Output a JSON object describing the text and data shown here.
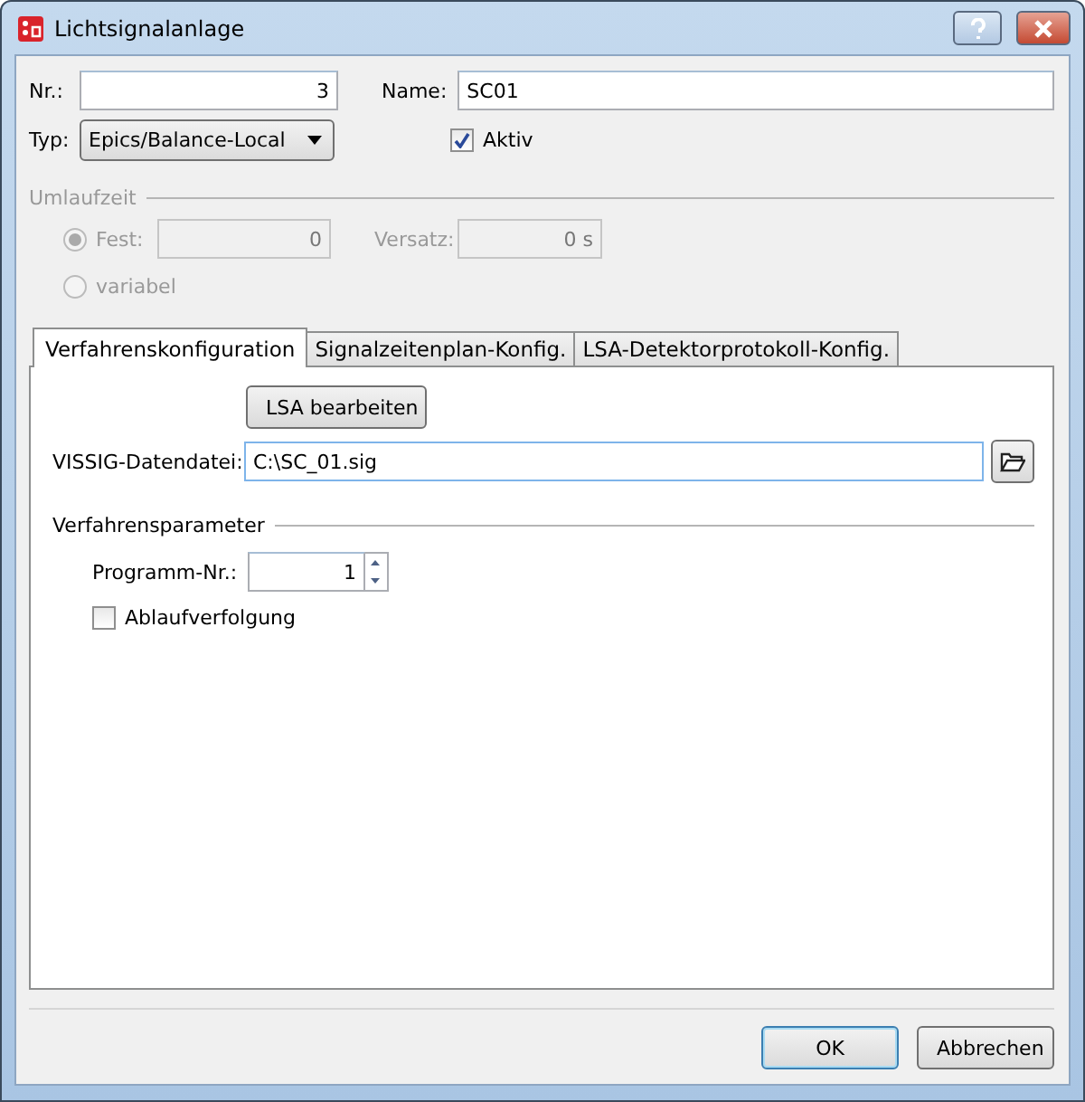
{
  "window": {
    "title": "Lichtsignalanlage"
  },
  "nr": {
    "label": "Nr.:",
    "value": "3"
  },
  "name": {
    "label": "Name:",
    "value": "SC01"
  },
  "typ": {
    "label": "Typ:",
    "value": "Epics/Balance-Local"
  },
  "aktiv": {
    "label": "Aktiv",
    "checked": true
  },
  "umlaufzeit": {
    "title": "Umlaufzeit",
    "disabled": true,
    "options": [
      {
        "label": "Fest:",
        "selected": true
      },
      {
        "label": "variabel",
        "selected": false
      }
    ],
    "fest_value": "0",
    "versatz": {
      "label": "Versatz:",
      "value": "0 s"
    }
  },
  "tabs": [
    {
      "label": "Verfahrenskonfiguration",
      "selected": true
    },
    {
      "label": "Signalzeitenplan-Konfig.",
      "selected": false
    },
    {
      "label": "LSA-Detektorprotokoll-Konfig.",
      "selected": false
    }
  ],
  "panel": {
    "edit_button": "LSA bearbeiten",
    "file": {
      "label": "VISSIG-Datendatei:",
      "value": "C:\\SC_01.sig"
    },
    "params_title": "Verfahrensparameter",
    "program": {
      "label": "Programm-Nr.:",
      "value": "1"
    },
    "trace": {
      "label": "Ablaufverfolgung",
      "checked": false
    }
  },
  "buttons": [
    {
      "label": "OK",
      "default": true
    },
    {
      "label": "Abbrechen",
      "default": false
    }
  ]
}
